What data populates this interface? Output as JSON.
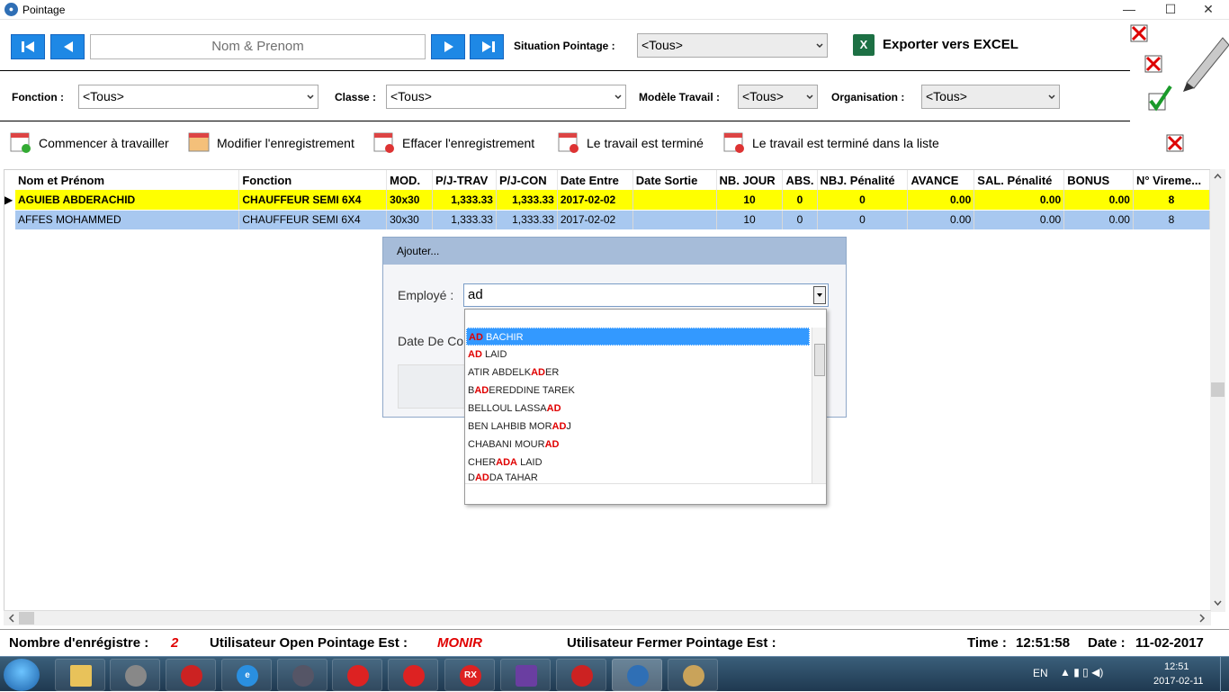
{
  "window": {
    "title": "Pointage",
    "minimize": "—",
    "maximize": "☐",
    "close": "✕"
  },
  "navigation": {
    "name_placeholder": "Nom & Prenom"
  },
  "filters": {
    "situation_label": "Situation Pointage :",
    "situation_value": "<Tous>",
    "fonction_label": "Fonction :",
    "fonction_value": "<Tous>",
    "classe_label": "Classe :",
    "classe_value": "<Tous>",
    "modele_label": "Modèle Travail :",
    "modele_value": "<Tous>",
    "organisation_label": "Organisation :",
    "organisation_value": "<Tous>"
  },
  "export": {
    "label": "Exporter vers EXCEL",
    "icon": "excel-icon"
  },
  "actions": [
    {
      "label": "Commencer à travailler",
      "icon": "calendar-add-icon"
    },
    {
      "label": "Modifier l'enregistrement",
      "icon": "calendar-edit-icon"
    },
    {
      "label": "Effacer l'enregistrement",
      "icon": "calendar-delete-icon"
    },
    {
      "label": "Le travail est terminé",
      "icon": "calendar-stop-icon"
    },
    {
      "label": "Le travail est terminé dans la liste",
      "icon": "calendar-stop-list-icon"
    }
  ],
  "grid": {
    "columns": [
      "Nom et Prénom",
      "Fonction",
      "MOD.",
      "P/J-TRAV",
      "P/J-CON",
      "Date Entre",
      "Date Sortie",
      "NB. JOUR",
      "ABS.",
      "NBJ. Pénalité",
      "AVANCE",
      "SAL. Pénalité",
      "BONUS",
      "N° Vireme..."
    ],
    "rows": [
      [
        "AGUIEB ABDERACHID",
        "CHAUFFEUR SEMI 6X4",
        "30x30",
        "1,333.33",
        "1,333.33",
        "2017-02-02",
        "",
        "10",
        "0",
        "0",
        "0.00",
        "0.00",
        "0.00",
        "8"
      ],
      [
        "AFFES MOHAMMED",
        "CHAUFFEUR SEMI 6X4",
        "30x30",
        "1,333.33",
        "1,333.33",
        "2017-02-02",
        "",
        "10",
        "0",
        "0",
        "0.00",
        "0.00",
        "0.00",
        "8"
      ]
    ]
  },
  "dialog": {
    "title": "Ajouter...",
    "employe_label": "Employé :",
    "employe_value": "ad",
    "date_label": "Date De Co",
    "suggestions": [
      {
        "pre": "",
        "hit": "AD",
        "post": " BACHIR"
      },
      {
        "pre": "",
        "hit": "AD",
        "post": " LAID"
      },
      {
        "pre": "ATIR ABDELK",
        "hit": "AD",
        "post": "ER"
      },
      {
        "pre": "B",
        "hit": "AD",
        "post": "EREDDINE TAREK"
      },
      {
        "pre": "BELLOUL LASSA",
        "hit": "AD",
        "post": ""
      },
      {
        "pre": "BEN LAHBIB MOR",
        "hit": "AD",
        "post": "J"
      },
      {
        "pre": "CHABANI MOUR",
        "hit": "AD",
        "post": ""
      },
      {
        "pre": "CHER",
        "hit": "ADA",
        "post": " LAID"
      },
      {
        "pre": "D",
        "hit": "AD",
        "post": "DA TAHAR"
      }
    ]
  },
  "status": {
    "count_label": "Nombre d'enrégistre :",
    "count_value": "2",
    "open_label": "Utilisateur Open Pointage Est :",
    "open_value": "MONIR",
    "close_label": "Utilisateur Fermer Pointage Est :",
    "time_label": "Time :",
    "time_value": "12:51:58",
    "date_label": "Date :",
    "date_value": "11-02-2017"
  },
  "taskbar": {
    "lang": "EN",
    "clock_time": "12:51",
    "clock_date": "2017-02-11",
    "apps": [
      "file-explorer-icon",
      "paint-icon",
      "media-player-icon",
      "internet-explorer-icon",
      "tools-icon",
      "bank-icon",
      "bank-icon-2",
      "rx-icon",
      "visual-studio-icon",
      "media-player-icon-2",
      "users-icon",
      "paint-palette-icon"
    ],
    "rx_label": "RX"
  }
}
